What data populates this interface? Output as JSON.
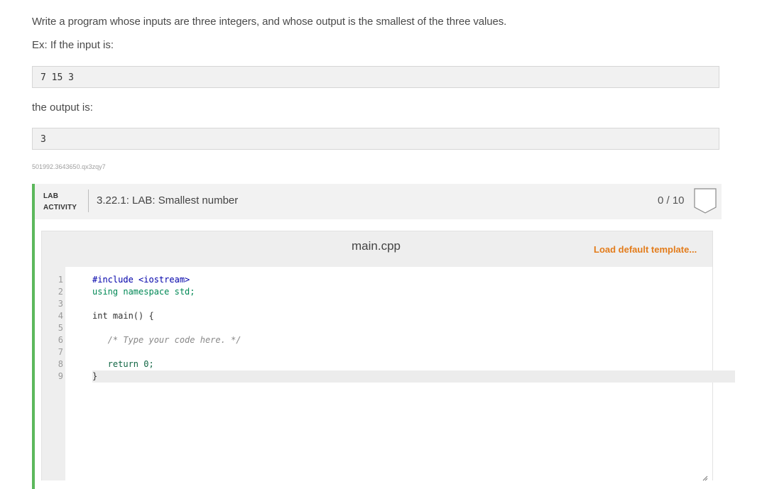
{
  "problem": {
    "description": "Write a program whose inputs are three integers, and whose output is the smallest of the three values.",
    "example_label": "Ex: If the input is:",
    "example_input": "7 15 3",
    "output_label": "the output is:",
    "example_output": "3",
    "activity_id": "501992.3643650.qx3zqy7"
  },
  "lab": {
    "tag_line1": "LAB",
    "tag_line2": "ACTIVITY",
    "title": "3.22.1: LAB: Smallest number",
    "score": "0 / 10",
    "accent_color": "#5cb85c"
  },
  "editor": {
    "file_name": "main.cpp",
    "load_template_label": "Load default template...",
    "load_template_color": "#e37c1b",
    "line_numbers": [
      "1",
      "2",
      "3",
      "4",
      "5",
      "6",
      "7",
      "8",
      "9"
    ],
    "lines": [
      "#include <iostream>",
      "using namespace std;",
      "",
      "int main() {",
      "",
      "   /* Type your code here. */",
      "",
      "   return 0;",
      "}"
    ]
  }
}
